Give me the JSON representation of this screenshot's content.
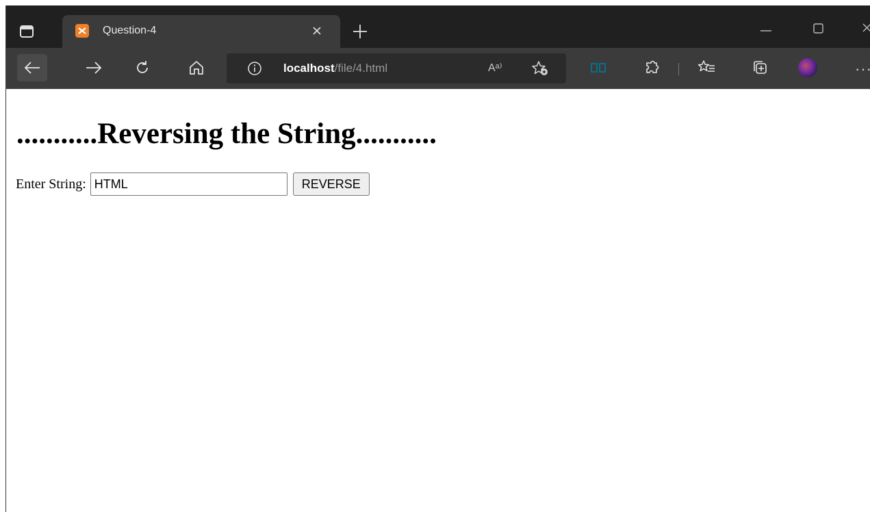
{
  "browser": {
    "tab": {
      "title": "Question-4"
    },
    "address": {
      "host": "localhost",
      "path": "/file/4.html"
    },
    "read_aloud_glyph": "Aᵃ⁾",
    "more_glyph": "···"
  },
  "page": {
    "heading": "...........Reversing the String...........",
    "form": {
      "label": "Enter String:",
      "input_value": "HTML",
      "button_label": "REVERSE"
    }
  },
  "colors": {
    "tabstrip": "#202020",
    "toolbar": "#3b3b3b",
    "favicon": "#f07f2a"
  },
  "icons": [
    "tab-actions-icon",
    "close-icon",
    "plus-icon",
    "minimize-icon",
    "maximize-icon",
    "window-close-icon",
    "back-arrow-icon",
    "forward-arrow-icon",
    "refresh-icon",
    "home-icon",
    "info-icon",
    "read-aloud-icon",
    "add-favorite-icon",
    "immersive-reader-icon",
    "extensions-icon",
    "favorites-icon",
    "collections-icon",
    "profile-avatar",
    "more-icon"
  ]
}
